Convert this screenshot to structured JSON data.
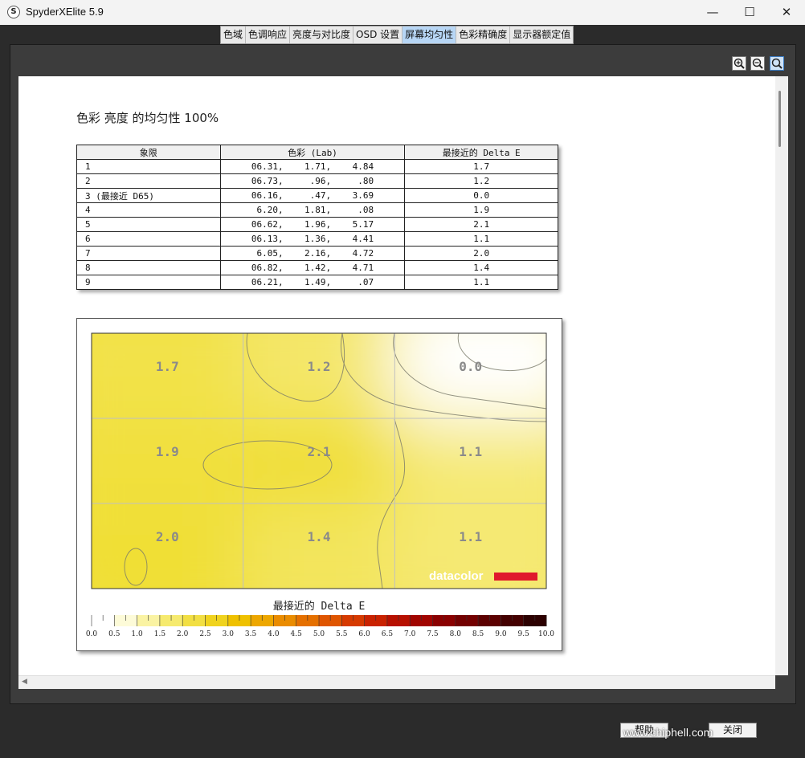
{
  "window": {
    "title": "SpyderXElite 5.9",
    "icon_letter": "S",
    "minimize": "—",
    "maximize": "☐",
    "close": "✕"
  },
  "tabs": [
    {
      "label": "色域",
      "active": false
    },
    {
      "label": "色调响应",
      "active": false
    },
    {
      "label": "亮度与对比度",
      "active": false
    },
    {
      "label": "OSD 设置",
      "active": false
    },
    {
      "label": "屏幕均匀性",
      "active": true
    },
    {
      "label": "色彩精确度",
      "active": false
    },
    {
      "label": "显示器额定值",
      "active": false
    }
  ],
  "zoom_tools": [
    "zoom-in-icon",
    "zoom-out-icon",
    "zoom-fit-icon"
  ],
  "report": {
    "title": "色彩 亮度 的均匀性 100%",
    "table": {
      "headers": [
        "象限",
        "色彩 (Lab)",
        "最接近的 Delta E"
      ],
      "rows": [
        [
          "1",
          "06.31,    1.71,    4.84",
          "1.7"
        ],
        [
          "2",
          "06.73,     .96,     .80",
          "1.2"
        ],
        [
          "3 (最接近 D65)",
          "06.16,     .47,    3.69",
          "0.0"
        ],
        [
          "4",
          " 6.20,    1.81,     .08",
          "1.9"
        ],
        [
          "5",
          "06.62,    1.96,    5.17",
          "2.1"
        ],
        [
          "6",
          "06.13,    1.36,    4.41",
          "1.1"
        ],
        [
          "7",
          " 6.05,    2.16,    4.72",
          "2.0"
        ],
        [
          "8",
          "06.82,    1.42,    4.71",
          "1.4"
        ],
        [
          "9",
          "06.21,    1.49,     .07",
          "1.1"
        ]
      ]
    }
  },
  "chart_data": {
    "type": "heatmap",
    "grid_rows": 3,
    "grid_cols": 3,
    "values": [
      [
        1.7,
        1.2,
        0.0
      ],
      [
        1.9,
        2.1,
        1.1
      ],
      [
        2.0,
        1.4,
        1.1
      ]
    ],
    "labels": [
      [
        "1.7",
        "1.2",
        "0.0"
      ],
      [
        "1.9",
        "2.1",
        "1.1"
      ],
      [
        "2.0",
        "1.4",
        "1.1"
      ]
    ],
    "logo": "datacolor",
    "colorbar_title": "最接近的 Delta E",
    "colorbar_ticks": [
      "0.0",
      "0.5",
      "1.0",
      "1.5",
      "2.0",
      "2.5",
      "3.0",
      "3.5",
      "4.0",
      "4.5",
      "5.0",
      "5.5",
      "6.0",
      "6.5",
      "7.0",
      "7.5",
      "8.0",
      "8.5",
      "9.0",
      "9.5",
      "10.0"
    ],
    "colorbar_range": [
      0,
      10
    ],
    "colors": [
      "#ffffff",
      "#fdfbd8",
      "#faf3a3",
      "#f6ea6e",
      "#f2df43",
      "#f0d31e",
      "#efc100",
      "#eda700",
      "#ea8c00",
      "#e57000",
      "#df5500",
      "#d63a00",
      "#c92200",
      "#b71000",
      "#a10500",
      "#8a0000",
      "#730000",
      "#5c0000",
      "#440000",
      "#2c0000",
      "#120000"
    ]
  },
  "footer": {
    "left_button": "帮助",
    "right_button": "关闭",
    "watermark": "www.chiphell.com"
  }
}
